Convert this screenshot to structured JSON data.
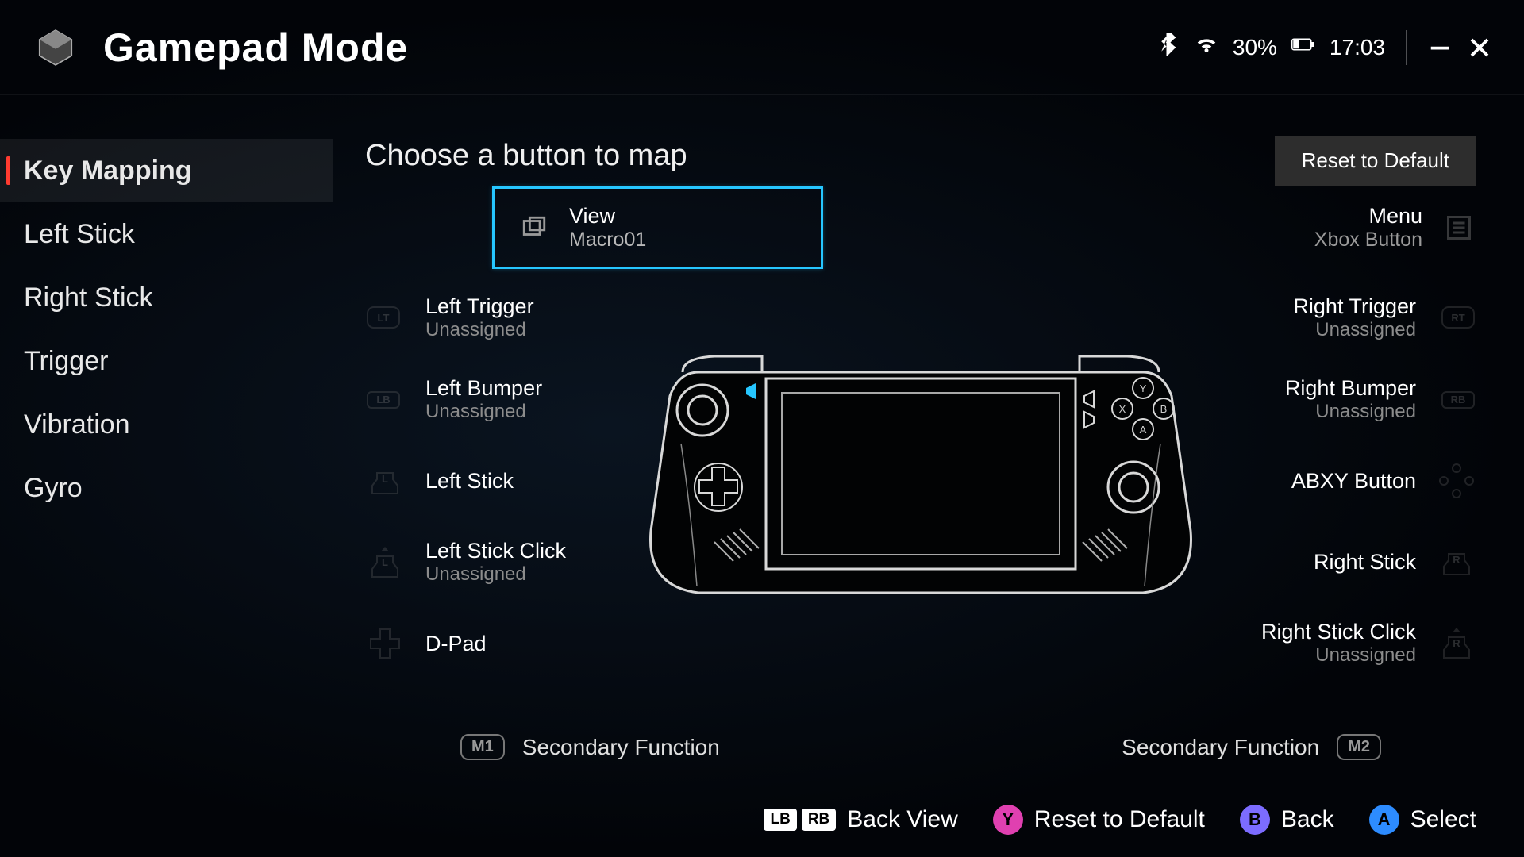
{
  "header": {
    "title": "Gamepad Mode",
    "battery_pct": "30%",
    "time": "17:03"
  },
  "sidebar": {
    "items": [
      {
        "label": "Key Mapping",
        "active": true
      },
      {
        "label": "Left Stick",
        "active": false
      },
      {
        "label": "Right Stick",
        "active": false
      },
      {
        "label": "Trigger",
        "active": false
      },
      {
        "label": "Vibration",
        "active": false
      },
      {
        "label": "Gyro",
        "active": false
      }
    ]
  },
  "main": {
    "title": "Choose a button to map",
    "reset": "Reset to Default",
    "view": {
      "title": "View",
      "sub": "Macro01"
    },
    "menu": {
      "title": "Menu",
      "sub": "Xbox Button"
    }
  },
  "left_col": [
    {
      "name": "Left Trigger",
      "sub": "Unassigned",
      "tag": "LT"
    },
    {
      "name": "Left Bumper",
      "sub": "Unassigned",
      "tag": "LB"
    },
    {
      "name": "Left Stick",
      "sub": "",
      "tag": "L"
    },
    {
      "name": "Left Stick Click",
      "sub": "Unassigned",
      "tag": "L"
    },
    {
      "name": "D-Pad",
      "sub": "",
      "tag": "+"
    }
  ],
  "right_col": [
    {
      "name": "Right Trigger",
      "sub": "Unassigned",
      "tag": "RT"
    },
    {
      "name": "Right Bumper",
      "sub": "Unassigned",
      "tag": "RB"
    },
    {
      "name": "ABXY Button",
      "sub": "",
      "tag": "abxy"
    },
    {
      "name": "Right Stick",
      "sub": "",
      "tag": "R"
    },
    {
      "name": "Right Stick Click",
      "sub": "Unassigned",
      "tag": "R"
    }
  ],
  "secondary": {
    "left": {
      "tag": "M1",
      "label": "Secondary Function"
    },
    "right": {
      "tag": "M2",
      "label": "Secondary Function"
    }
  },
  "footer": {
    "lb": "LB",
    "rb": "RB",
    "backview": "Back View",
    "reset": "Reset to Default",
    "back": "Back",
    "select": "Select"
  }
}
